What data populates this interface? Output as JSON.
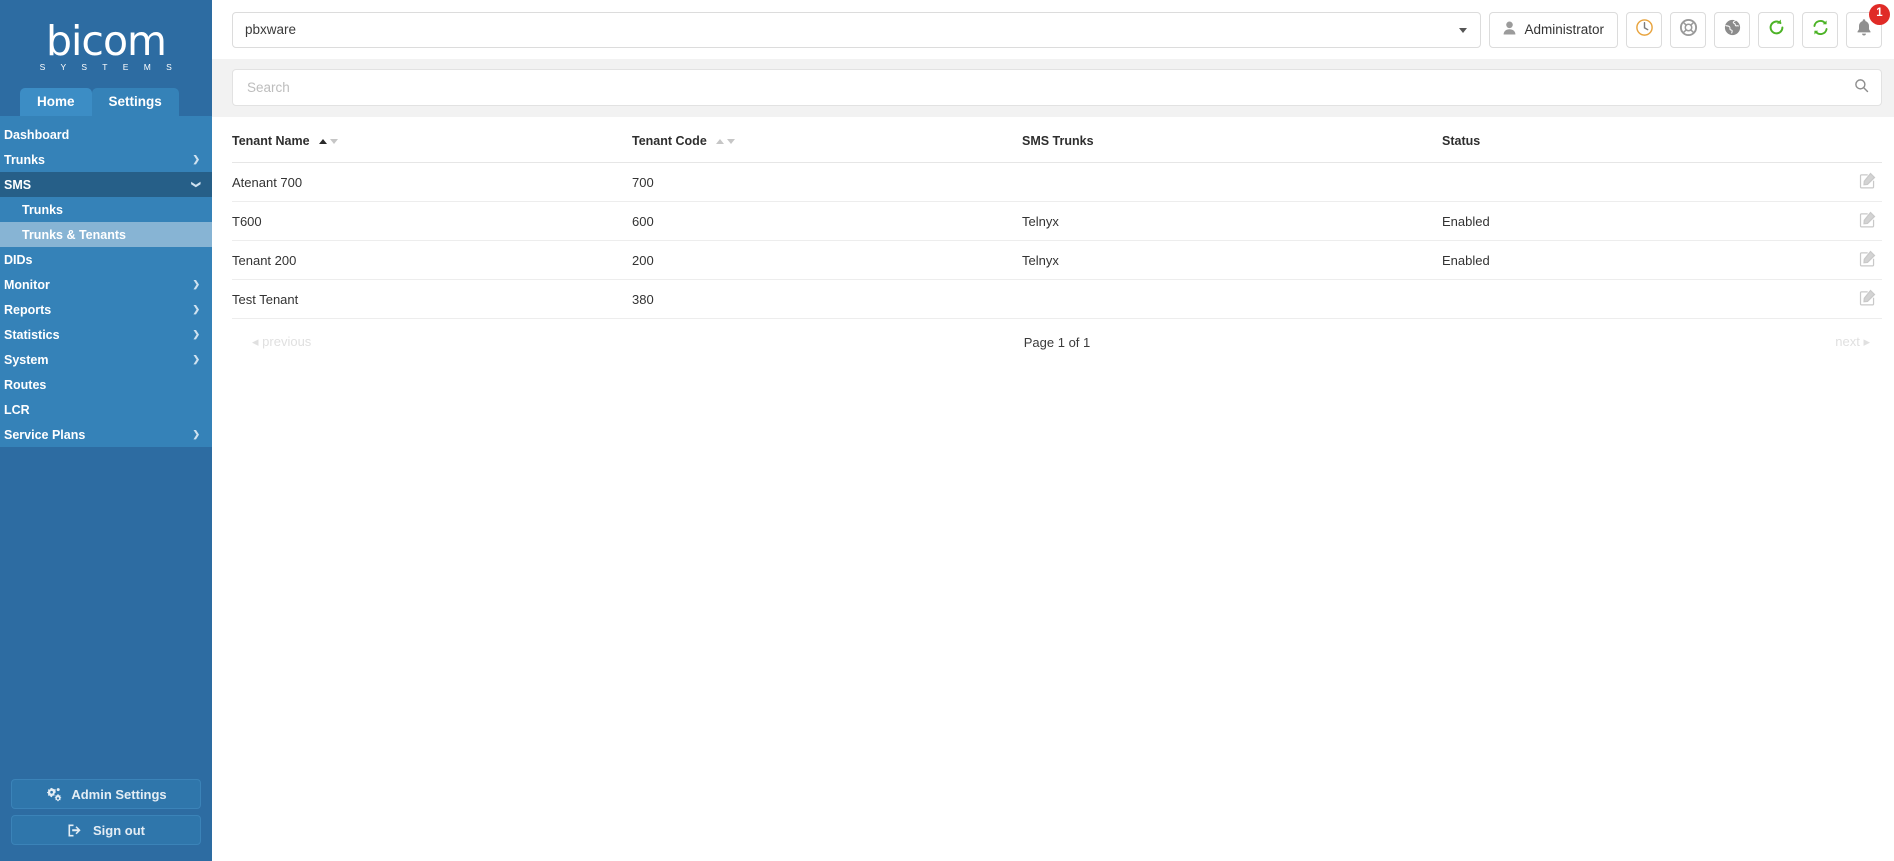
{
  "brand": {
    "logo_text": "bicom",
    "logo_subtext": "S Y S T E M S",
    "sidebar_bg": "#3582b8",
    "sidebar_header_bg": "#2d6ca2",
    "active_sub_bg": "#87b4d4",
    "open_section_bg": "#265f88",
    "badge_color": "#e02b27"
  },
  "tabs": [
    {
      "label": "Home",
      "active": true
    },
    {
      "label": "Settings",
      "active": false
    }
  ],
  "sidebar": {
    "items": [
      {
        "label": "Dashboard",
        "chevron": "none",
        "state": "normal"
      },
      {
        "label": "Trunks",
        "chevron": "right",
        "state": "normal"
      },
      {
        "label": "SMS",
        "chevron": "down",
        "state": "open"
      },
      {
        "label": "Trunks",
        "chevron": "none",
        "state": "sub"
      },
      {
        "label": "Trunks & Tenants",
        "chevron": "none",
        "state": "sub-selected"
      },
      {
        "label": "DIDs",
        "chevron": "none",
        "state": "normal"
      },
      {
        "label": "Monitor",
        "chevron": "right",
        "state": "normal"
      },
      {
        "label": "Reports",
        "chevron": "right",
        "state": "normal"
      },
      {
        "label": "Statistics",
        "chevron": "right",
        "state": "normal"
      },
      {
        "label": "System",
        "chevron": "right",
        "state": "normal"
      },
      {
        "label": "Routes",
        "chevron": "none",
        "state": "normal"
      },
      {
        "label": "LCR",
        "chevron": "none",
        "state": "normal"
      },
      {
        "label": "Service Plans",
        "chevron": "right",
        "state": "normal"
      }
    ],
    "admin_settings_label": "Admin Settings",
    "sign_out_label": "Sign out"
  },
  "topbar": {
    "server_value": "pbxware",
    "user_label": "Administrator",
    "icons": [
      {
        "name": "clock-icon",
        "glyph": "clock"
      },
      {
        "name": "lifebuoy-icon",
        "glyph": "lifebuoy"
      },
      {
        "name": "globe-icon",
        "glyph": "globe"
      },
      {
        "name": "reload-icon",
        "glyph": "reload"
      },
      {
        "name": "sync-icon",
        "glyph": "sync"
      },
      {
        "name": "bell-icon",
        "glyph": "bell"
      }
    ],
    "notification_count": "1"
  },
  "search": {
    "value": "",
    "placeholder": "Search",
    "icon": "search-icon"
  },
  "table": {
    "columns": [
      {
        "label": "Tenant Name",
        "sortable": true,
        "sort": "asc"
      },
      {
        "label": "Tenant Code",
        "sortable": true,
        "sort": "none"
      },
      {
        "label": "SMS Trunks",
        "sortable": false,
        "sort": "none"
      },
      {
        "label": "Status",
        "sortable": false,
        "sort": "none"
      },
      {
        "label": "",
        "sortable": false,
        "sort": "none"
      }
    ],
    "rows": [
      {
        "tenant_name": "Atenant 700",
        "tenant_code": "700",
        "sms_trunks": "",
        "status": ""
      },
      {
        "tenant_name": "T600",
        "tenant_code": "600",
        "sms_trunks": "Telnyx",
        "status": "Enabled"
      },
      {
        "tenant_name": "Tenant 200",
        "tenant_code": "200",
        "sms_trunks": "Telnyx",
        "status": "Enabled"
      },
      {
        "tenant_name": "Test Tenant",
        "tenant_code": "380",
        "sms_trunks": "",
        "status": ""
      }
    ],
    "row_action_icon": "edit-icon"
  },
  "pagination": {
    "previous_label": "previous",
    "next_label": "next",
    "page_info": "Page 1 of 1"
  }
}
